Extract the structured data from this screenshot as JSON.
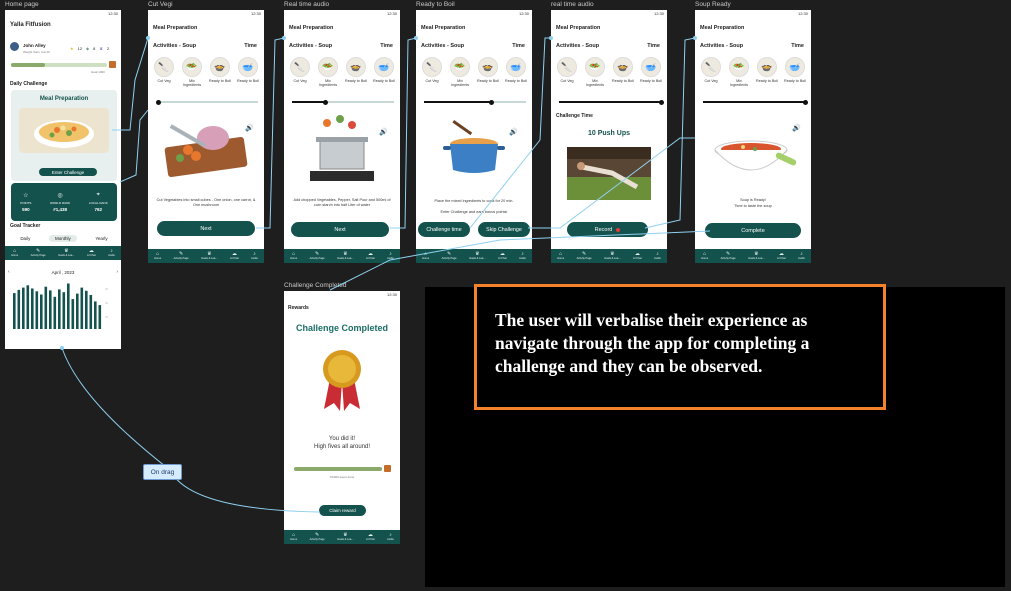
{
  "frame_labels": {
    "home": "Home page",
    "cut_vegi": "Cut Vegi",
    "rt_audio_1": "Real time audio",
    "ready_to_boil": "Ready to Boil",
    "rt_audio_2": "real time audio",
    "soup_ready": "Soup Ready",
    "challenge_completed": "Challenge Completed"
  },
  "status_time": "12:30",
  "nav_items": [
    "Home",
    "Activity Page",
    "Goals & Lea...",
    "AI Chat",
    "Audio"
  ],
  "home": {
    "app_title": "Yalla Fitfusion",
    "user_name": "John Alley",
    "user_sub": "Weight Gain, lost Fit",
    "badge_stars": "12",
    "badge_gems": "8",
    "badge_cups": "2",
    "progress_value": "Goal 1000",
    "daily_challenge": "Daily Challenge",
    "card_title": "Meal Preparation",
    "enter_btn": "Enter Challenge",
    "stats": [
      {
        "label": "POINTS",
        "value": "590"
      },
      {
        "label": "WORLD RANK",
        "value": "#1,438"
      },
      {
        "label": "LOCAL RANK",
        "value": "762"
      }
    ],
    "goal_tracker": "Goal Tracker",
    "tabs": [
      "Daily",
      "Monthly",
      "Yearly"
    ],
    "month": "April , 2023"
  },
  "activity": {
    "header": "Meal Preparation",
    "section": "Activities - Soup",
    "time": "Time",
    "steps": [
      "Cut Veg",
      "Mix Ingredients",
      "Ready to Boil",
      "Ready to Boil"
    ]
  },
  "screens": {
    "cut_vegi": {
      "desc": "Cut Vegetables into small cubes - One onion, one carrot, & One mushroom",
      "button": "Next",
      "progress": 0
    },
    "rt_audio_1": {
      "desc": "Add chopped Vegetables, Pepper, Salt Pour and 500ml of corn starch into half Liter of water",
      "button": "Next",
      "progress": 0.33
    },
    "ready_to_boil": {
      "desc": "Place the mixed ingredients to cook for 20 min.",
      "desc2": "Enter Challenge and earn bonus points!",
      "btn_left": "Challenge time",
      "btn_right": "Skip Challenge",
      "progress": 0.66
    },
    "rt_audio_2": {
      "challenge_time": "Challenge Time",
      "challenge_name": "10 Push Ups",
      "button": "Record",
      "progress": 1
    },
    "soup_ready": {
      "desc": "Soup is Ready!",
      "desc2": "Time to taste the soup",
      "button": "Complete",
      "progress": 1
    }
  },
  "rewards": {
    "header": "Rewards",
    "title": "Challenge Completed",
    "did_it": "You did it!",
    "high_fives": "High fives all around!",
    "progress_note": "70/200 steps done",
    "button": "Claim reward"
  },
  "on_drag": "On drag",
  "annotation": "The user will verbalise their experience as navigate through the app for completing a challenge and they can be observed.",
  "chart_bars": [
    0.78,
    0.85,
    0.9,
    0.95,
    0.88,
    0.82,
    0.75,
    0.92,
    0.84,
    0.7,
    0.86,
    0.8,
    0.99,
    0.65,
    0.77,
    0.9,
    0.83,
    0.74,
    0.6,
    0.52
  ],
  "colors": {
    "primary": "#14524d",
    "accent": "#f5812d",
    "background": "#1e1e1e"
  }
}
